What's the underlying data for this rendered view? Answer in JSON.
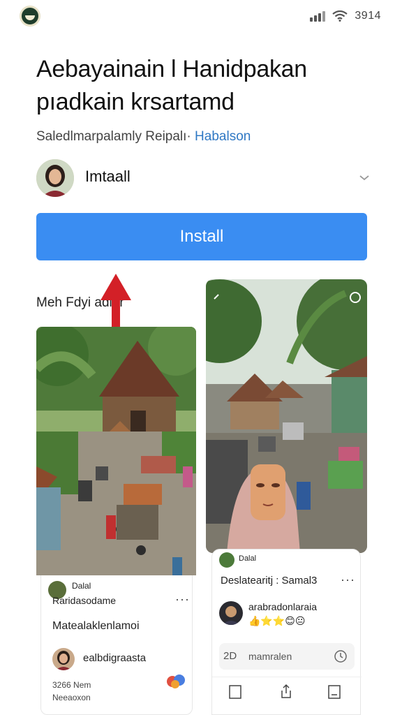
{
  "status_bar": {
    "time": "3914",
    "signal_icon": "cellular-signal-icon",
    "wifi_icon": "wifi-icon"
  },
  "header": {
    "title": "Aebayainain l Hanidpakan pıadkain krsartamd",
    "meta_prefix": "Saledlmarpalamly  Reipalı·",
    "meta_link": "Habalson"
  },
  "account": {
    "name": "Imtaall",
    "chevron_icon": "chevron-down-icon"
  },
  "install_button": {
    "label": "Install"
  },
  "section": {
    "label": "Meh Fdyi     adiar"
  },
  "left_card": {
    "account_label": "Dalal",
    "account_sub": "Raridasodame",
    "caption": "Matealaklenlamoi",
    "user": "ealbdigraasta",
    "footer_line1": "3266 Nem",
    "footer_line2": "Neeaoxon",
    "more_icon": "more-horizontal-icon"
  },
  "right_card": {
    "header_label": "Dalal",
    "title": "Deslatearitj : Samal3",
    "user": "arabradonlaraia",
    "reactions": "👍⭐⭐😊😐",
    "comment_count": "2D",
    "comment_placeholder": "mamralen",
    "more_icon": "more-horizontal-icon",
    "actions": [
      "square-icon",
      "share-icon",
      "bookmark-icon"
    ]
  },
  "colors": {
    "install_button": "#3a8df2",
    "link": "#2f78c4",
    "arrow": "#d32027"
  }
}
